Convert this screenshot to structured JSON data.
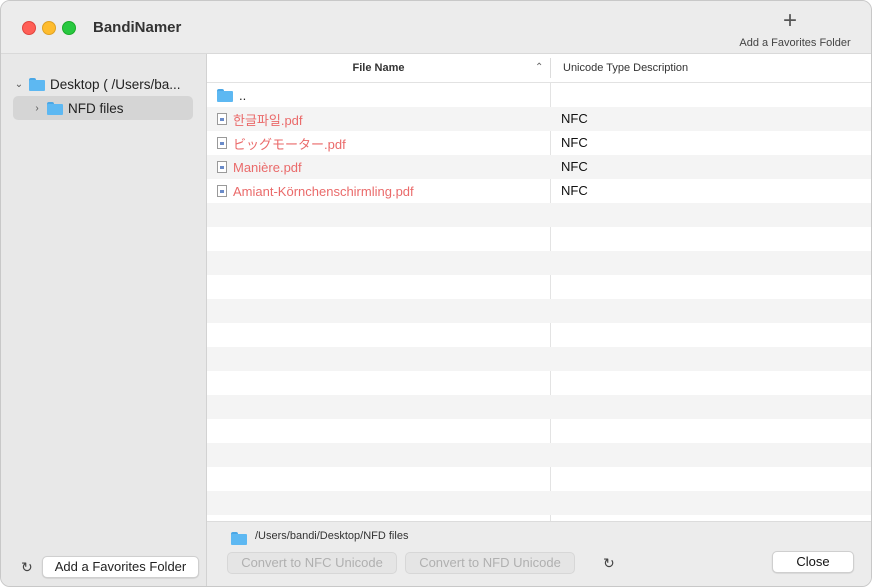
{
  "app": {
    "title": "BandiNamer"
  },
  "toolbar": {
    "add_favorites_icon": "plus-icon",
    "add_favorites_label": "Add a Favorites Folder"
  },
  "sidebar": {
    "items": [
      {
        "label": "Desktop ( /Users/ba...",
        "expanded": true,
        "icon": "folder-icon"
      },
      {
        "label": "NFD files",
        "expanded": false,
        "selected": true,
        "icon": "folder-icon"
      }
    ],
    "refresh_icon": "refresh-icon",
    "add_button_label": "Add a Favorites Folder"
  },
  "table": {
    "columns": {
      "name": "File Name",
      "desc": "Unicode Type Description"
    },
    "sort_indicator": "^",
    "rows": [
      {
        "name": "..",
        "desc": "",
        "type": "parent"
      },
      {
        "name": "한글파일.pdf",
        "desc": "NFC",
        "type": "pdf"
      },
      {
        "name": "ビッグモーター.pdf",
        "desc": "NFC",
        "type": "pdf"
      },
      {
        "name": "Manière.pdf",
        "desc": "NFC",
        "type": "pdf"
      },
      {
        "name": "Amiant-Körnchenschirmling.pdf",
        "desc": "NFC",
        "type": "pdf"
      }
    ]
  },
  "bottom": {
    "path": "/Users/bandi/Desktop/NFD files",
    "convert_nfc_label": "Convert to NFC Unicode",
    "convert_nfd_label": "Convert to NFD Unicode",
    "close_label": "Close"
  },
  "colors": {
    "filename_accent": "#ea6a6a",
    "folder": "#5db8f2"
  }
}
